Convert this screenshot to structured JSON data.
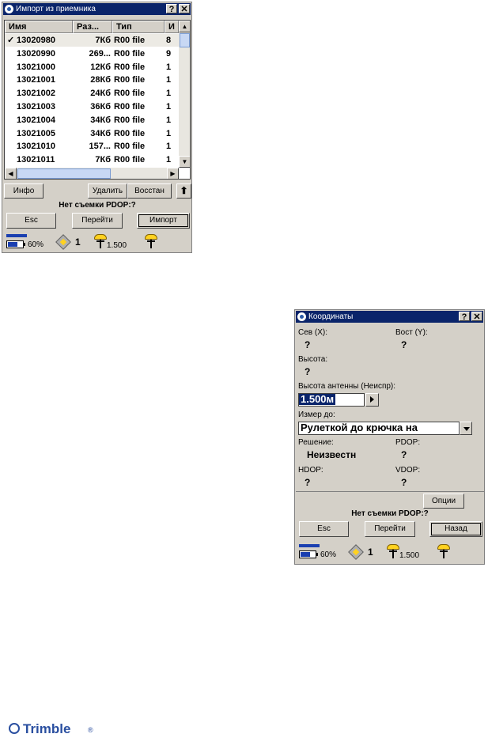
{
  "window1": {
    "title": "Импорт из приемника",
    "help": "?",
    "close": "✕",
    "columns": [
      "Имя",
      "Раз...",
      "Тип",
      "И"
    ],
    "rows": [
      {
        "check": "✓",
        "name": "13020980",
        "size": "7Кб",
        "type": "R00 file",
        "extra": "8"
      },
      {
        "check": "",
        "name": "13020990",
        "size": "269...",
        "type": "R00 file",
        "extra": "9"
      },
      {
        "check": "",
        "name": "13021000",
        "size": "12Кб",
        "type": "R00 file",
        "extra": "1"
      },
      {
        "check": "",
        "name": "13021001",
        "size": "28Кб",
        "type": "R00 file",
        "extra": "1"
      },
      {
        "check": "",
        "name": "13021002",
        "size": "24Кб",
        "type": "R00 file",
        "extra": "1"
      },
      {
        "check": "",
        "name": "13021003",
        "size": "36Кб",
        "type": "R00 file",
        "extra": "1"
      },
      {
        "check": "",
        "name": "13021004",
        "size": "34Кб",
        "type": "R00 file",
        "extra": "1"
      },
      {
        "check": "",
        "name": "13021005",
        "size": "34Кб",
        "type": "R00 file",
        "extra": "1"
      },
      {
        "check": "",
        "name": "13021010",
        "size": "157...",
        "type": "R00 file",
        "extra": "1"
      },
      {
        "check": "",
        "name": "13021011",
        "size": "7Кб",
        "type": "R00 file",
        "extra": "1"
      }
    ],
    "btn_info": "Инфо",
    "btn_delete": "Удалить",
    "btn_restore": "Восстан",
    "btn_up": "🡅",
    "status": "Нет съемки  PDOP:?",
    "btn_esc": "Esc",
    "btn_goto": "Перейти",
    "btn_import": "Импорт"
  },
  "statusbar": {
    "battery": "60%",
    "sat_count": "1",
    "antenna_height": "1.500"
  },
  "window2": {
    "title": "Координаты",
    "help": "?",
    "close": "✕",
    "north_label": "Сев  (X):",
    "north_value": "?",
    "east_label": "Вост (Y):",
    "east_value": "?",
    "height_label": "Высота:",
    "height_value": "?",
    "antenna_label": "Высота антенны (Неиспр):",
    "antenna_value": "1.500м",
    "measure_label": "Измер до:",
    "measure_value": "Рулеткой до крючка на",
    "solution_label": "Решение:",
    "solution_value": "Неизвестн",
    "pdop_label": "PDOP:",
    "pdop_value": "?",
    "hdop_label": "HDOP:",
    "hdop_value": "?",
    "vdop_label": "VDOP:",
    "vdop_value": "?",
    "btn_options": "Опции",
    "status": "Нет съемки  PDOP:?",
    "btn_esc": "Esc",
    "btn_goto": "Перейти",
    "btn_back": "Назад"
  },
  "brand": {
    "name": "Trimble",
    "reg": "®"
  }
}
